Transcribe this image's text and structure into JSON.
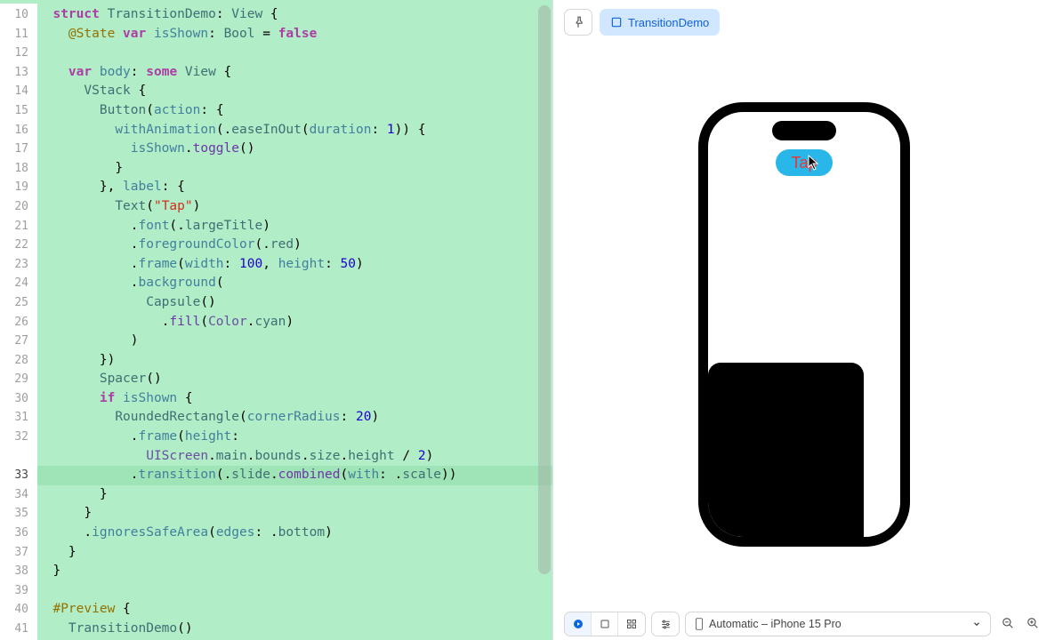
{
  "preview": {
    "chip_label": "TransitionDemo",
    "tap_label": "Tap",
    "device_label": "Automatic – iPhone 15 Pro"
  },
  "editor": {
    "current_line": 33,
    "lines": [
      {
        "n": 10,
        "indent": 1,
        "tokens": [
          [
            "kw",
            "struct"
          ],
          [
            "punc",
            " "
          ],
          [
            "typ",
            "TransitionDemo"
          ],
          [
            "punc",
            ": "
          ],
          [
            "typ",
            "View"
          ],
          [
            "punc",
            " {"
          ]
        ]
      },
      {
        "n": 11,
        "indent": 2,
        "tokens": [
          [
            "attr",
            "@State"
          ],
          [
            "punc",
            " "
          ],
          [
            "kw",
            "var"
          ],
          [
            "punc",
            " "
          ],
          [
            "prop",
            "isShown"
          ],
          [
            "punc",
            ": "
          ],
          [
            "typ",
            "Bool"
          ],
          [
            "punc",
            " = "
          ],
          [
            "bool",
            "false"
          ]
        ]
      },
      {
        "n": 12,
        "indent": 0,
        "tokens": []
      },
      {
        "n": 13,
        "indent": 2,
        "tokens": [
          [
            "kw",
            "var"
          ],
          [
            "punc",
            " "
          ],
          [
            "prop",
            "body"
          ],
          [
            "punc",
            ": "
          ],
          [
            "kw",
            "some"
          ],
          [
            "punc",
            " "
          ],
          [
            "typ",
            "View"
          ],
          [
            "punc",
            " {"
          ]
        ]
      },
      {
        "n": 14,
        "indent": 3,
        "tokens": [
          [
            "typ",
            "VStack"
          ],
          [
            "punc",
            " {"
          ]
        ]
      },
      {
        "n": 15,
        "indent": 4,
        "tokens": [
          [
            "typ",
            "Button"
          ],
          [
            "punc",
            "("
          ],
          [
            "prop",
            "action"
          ],
          [
            "punc",
            ": {"
          ]
        ]
      },
      {
        "n": 16,
        "indent": 5,
        "tokens": [
          [
            "fn2",
            "withAnimation"
          ],
          [
            "punc",
            "(."
          ],
          [
            "mem",
            "easeInOut"
          ],
          [
            "punc",
            "("
          ],
          [
            "prop",
            "duration"
          ],
          [
            "punc",
            ": "
          ],
          [
            "num",
            "1"
          ],
          [
            "punc",
            ")) {"
          ]
        ]
      },
      {
        "n": 17,
        "indent": 6,
        "tokens": [
          [
            "prop",
            "isShown"
          ],
          [
            "punc",
            "."
          ],
          [
            "fn",
            "toggle"
          ],
          [
            "punc",
            "()"
          ]
        ]
      },
      {
        "n": 18,
        "indent": 5,
        "tokens": [
          [
            "punc",
            "}"
          ]
        ]
      },
      {
        "n": 19,
        "indent": 4,
        "tokens": [
          [
            "punc",
            "}, "
          ],
          [
            "prop",
            "label"
          ],
          [
            "punc",
            ": {"
          ]
        ]
      },
      {
        "n": 20,
        "indent": 5,
        "tokens": [
          [
            "typ",
            "Text"
          ],
          [
            "punc",
            "("
          ],
          [
            "str",
            "\"Tap\""
          ],
          [
            "punc",
            ")"
          ]
        ]
      },
      {
        "n": 21,
        "indent": 6,
        "tokens": [
          [
            "punc",
            "."
          ],
          [
            "fn2",
            "font"
          ],
          [
            "punc",
            "(."
          ],
          [
            "mem",
            "largeTitle"
          ],
          [
            "punc",
            ")"
          ]
        ]
      },
      {
        "n": 22,
        "indent": 6,
        "tokens": [
          [
            "punc",
            "."
          ],
          [
            "fn2",
            "foregroundColor"
          ],
          [
            "punc",
            "(."
          ],
          [
            "mem",
            "red"
          ],
          [
            "punc",
            ")"
          ]
        ]
      },
      {
        "n": 23,
        "indent": 6,
        "tokens": [
          [
            "punc",
            "."
          ],
          [
            "fn2",
            "frame"
          ],
          [
            "punc",
            "("
          ],
          [
            "prop",
            "width"
          ],
          [
            "punc",
            ": "
          ],
          [
            "num",
            "100"
          ],
          [
            "punc",
            ", "
          ],
          [
            "prop",
            "height"
          ],
          [
            "punc",
            ": "
          ],
          [
            "num",
            "50"
          ],
          [
            "punc",
            ")"
          ]
        ]
      },
      {
        "n": 24,
        "indent": 6,
        "tokens": [
          [
            "punc",
            "."
          ],
          [
            "fn2",
            "background"
          ],
          [
            "punc",
            "("
          ]
        ]
      },
      {
        "n": 25,
        "indent": 7,
        "tokens": [
          [
            "typ",
            "Capsule"
          ],
          [
            "punc",
            "()"
          ]
        ]
      },
      {
        "n": 26,
        "indent": 8,
        "tokens": [
          [
            "punc",
            "."
          ],
          [
            "fn",
            "fill"
          ],
          [
            "punc",
            "("
          ],
          [
            "typ2",
            "Color"
          ],
          [
            "punc",
            "."
          ],
          [
            "mem",
            "cyan"
          ],
          [
            "punc",
            ")"
          ]
        ]
      },
      {
        "n": 27,
        "indent": 6,
        "tokens": [
          [
            "punc",
            ")"
          ]
        ]
      },
      {
        "n": 28,
        "indent": 4,
        "tokens": [
          [
            "punc",
            "})"
          ]
        ]
      },
      {
        "n": 29,
        "indent": 4,
        "tokens": [
          [
            "typ",
            "Spacer"
          ],
          [
            "punc",
            "()"
          ]
        ]
      },
      {
        "n": 30,
        "indent": 4,
        "tokens": [
          [
            "kw",
            "if"
          ],
          [
            "punc",
            " "
          ],
          [
            "prop",
            "isShown"
          ],
          [
            "punc",
            " {"
          ]
        ]
      },
      {
        "n": 31,
        "indent": 5,
        "tokens": [
          [
            "typ",
            "RoundedRectangle"
          ],
          [
            "punc",
            "("
          ],
          [
            "prop",
            "cornerRadius"
          ],
          [
            "punc",
            ": "
          ],
          [
            "num",
            "20"
          ],
          [
            "punc",
            ")"
          ]
        ]
      },
      {
        "n": 32,
        "indent": 6,
        "tokens": [
          [
            "punc",
            "."
          ],
          [
            "fn2",
            "frame"
          ],
          [
            "punc",
            "("
          ],
          [
            "prop",
            "height"
          ],
          [
            "punc",
            ":"
          ]
        ]
      },
      {
        "n": "",
        "n2": "",
        "indent": 7,
        "tokens": [
          [
            "typ2",
            "UIScreen"
          ],
          [
            "punc",
            "."
          ],
          [
            "mem",
            "main"
          ],
          [
            "punc",
            "."
          ],
          [
            "mem",
            "bounds"
          ],
          [
            "punc",
            "."
          ],
          [
            "mem",
            "size"
          ],
          [
            "punc",
            "."
          ],
          [
            "mem",
            "height"
          ],
          [
            "punc",
            " / "
          ],
          [
            "num",
            "2"
          ],
          [
            "punc",
            ")"
          ]
        ]
      },
      {
        "n": 33,
        "indent": 6,
        "tokens": [
          [
            "punc",
            "."
          ],
          [
            "fn2",
            "transition"
          ],
          [
            "punc",
            "(."
          ],
          [
            "mem",
            "slide"
          ],
          [
            "punc",
            "."
          ],
          [
            "fn",
            "combined"
          ],
          [
            "punc",
            "("
          ],
          [
            "prop",
            "with"
          ],
          [
            "punc",
            ": ."
          ],
          [
            "mem",
            "scale"
          ],
          [
            "punc",
            "))"
          ]
        ]
      },
      {
        "n": 34,
        "indent": 4,
        "tokens": [
          [
            "punc",
            "}"
          ]
        ]
      },
      {
        "n": 35,
        "indent": 3,
        "tokens": [
          [
            "punc",
            "}"
          ]
        ]
      },
      {
        "n": 36,
        "indent": 3,
        "tokens": [
          [
            "punc",
            "."
          ],
          [
            "fn2",
            "ignoresSafeArea"
          ],
          [
            "punc",
            "("
          ],
          [
            "prop",
            "edges"
          ],
          [
            "punc",
            ": ."
          ],
          [
            "mem",
            "bottom"
          ],
          [
            "punc",
            ")"
          ]
        ]
      },
      {
        "n": 37,
        "indent": 2,
        "tokens": [
          [
            "punc",
            "}"
          ]
        ]
      },
      {
        "n": 38,
        "indent": 1,
        "tokens": [
          [
            "punc",
            "}"
          ]
        ]
      },
      {
        "n": 39,
        "indent": 0,
        "tokens": []
      },
      {
        "n": 40,
        "indent": 1,
        "tokens": [
          [
            "attr",
            "#Preview"
          ],
          [
            "punc",
            " {"
          ]
        ]
      },
      {
        "n": 41,
        "indent": 2,
        "tokens": [
          [
            "typ",
            "TransitionDemo"
          ],
          [
            "punc",
            "()"
          ]
        ]
      }
    ]
  }
}
